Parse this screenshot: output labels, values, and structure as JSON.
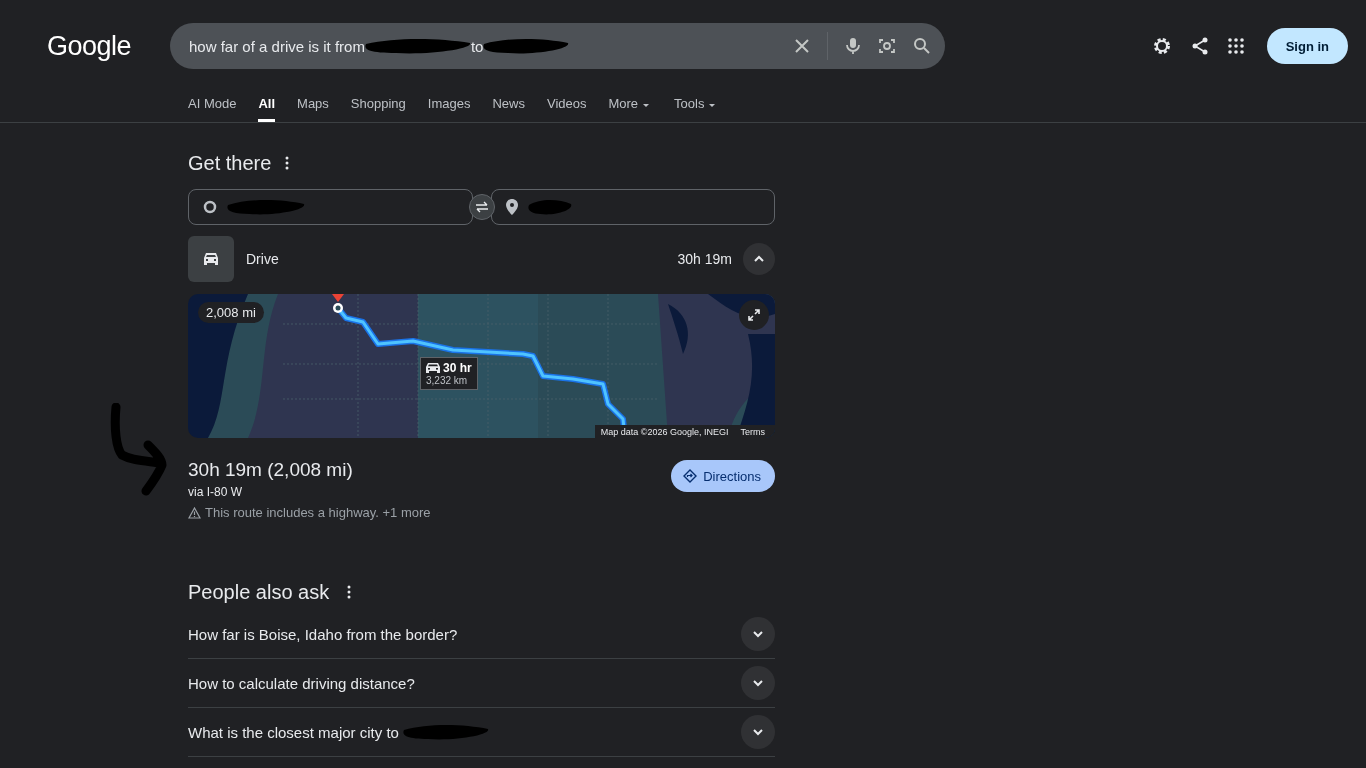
{
  "header": {
    "logo": "Google",
    "query": [
      {
        "kind": "text",
        "text": "how far of a drive is it from"
      },
      {
        "kind": "redacted"
      },
      {
        "kind": "text",
        "text": "to"
      },
      {
        "kind": "redacted"
      }
    ],
    "sign_in": "Sign in"
  },
  "tabs": [
    {
      "label": "AI Mode",
      "selected": false,
      "dropdown": false
    },
    {
      "label": "All",
      "selected": true,
      "dropdown": false
    },
    {
      "label": "Maps",
      "selected": false,
      "dropdown": false
    },
    {
      "label": "Shopping",
      "selected": false,
      "dropdown": false
    },
    {
      "label": "Images",
      "selected": false,
      "dropdown": false
    },
    {
      "label": "News",
      "selected": false,
      "dropdown": false
    },
    {
      "label": "Videos",
      "selected": false,
      "dropdown": false
    },
    {
      "label": "More",
      "selected": false,
      "dropdown": true
    },
    {
      "label": "Tools",
      "selected": false,
      "dropdown": true
    }
  ],
  "get_there": {
    "title": "Get there",
    "origin": {
      "kind": "redacted"
    },
    "destination": {
      "kind": "redacted"
    },
    "mode": {
      "label": "Drive",
      "duration": "30h 19m",
      "expanded": true
    },
    "map": {
      "kind": "picture",
      "distance_badge": "2,008 mi",
      "callout": {
        "time": "30 hr",
        "distance": "3,232 km"
      },
      "attribution": "Map data ©2026 Google, INEGI",
      "terms": "Terms"
    },
    "summary": "30h 19m (2,008 mi)",
    "via": "via I-80 W",
    "warning": "This route includes a highway. +1 more",
    "directions": "Directions"
  },
  "annotations": [
    {
      "kind": "arrow"
    }
  ],
  "people_also_ask": {
    "title": "People also ask",
    "questions": [
      {
        "parts": [
          {
            "kind": "text",
            "text": "How far is Boise, Idaho from the border?"
          }
        ],
        "expanded": false
      },
      {
        "parts": [
          {
            "kind": "text",
            "text": "How to calculate driving distance?"
          }
        ],
        "expanded": false
      },
      {
        "parts": [
          {
            "kind": "text",
            "text": "What is the closest major city to"
          },
          {
            "kind": "redacted"
          }
        ],
        "expanded": false
      }
    ]
  }
}
